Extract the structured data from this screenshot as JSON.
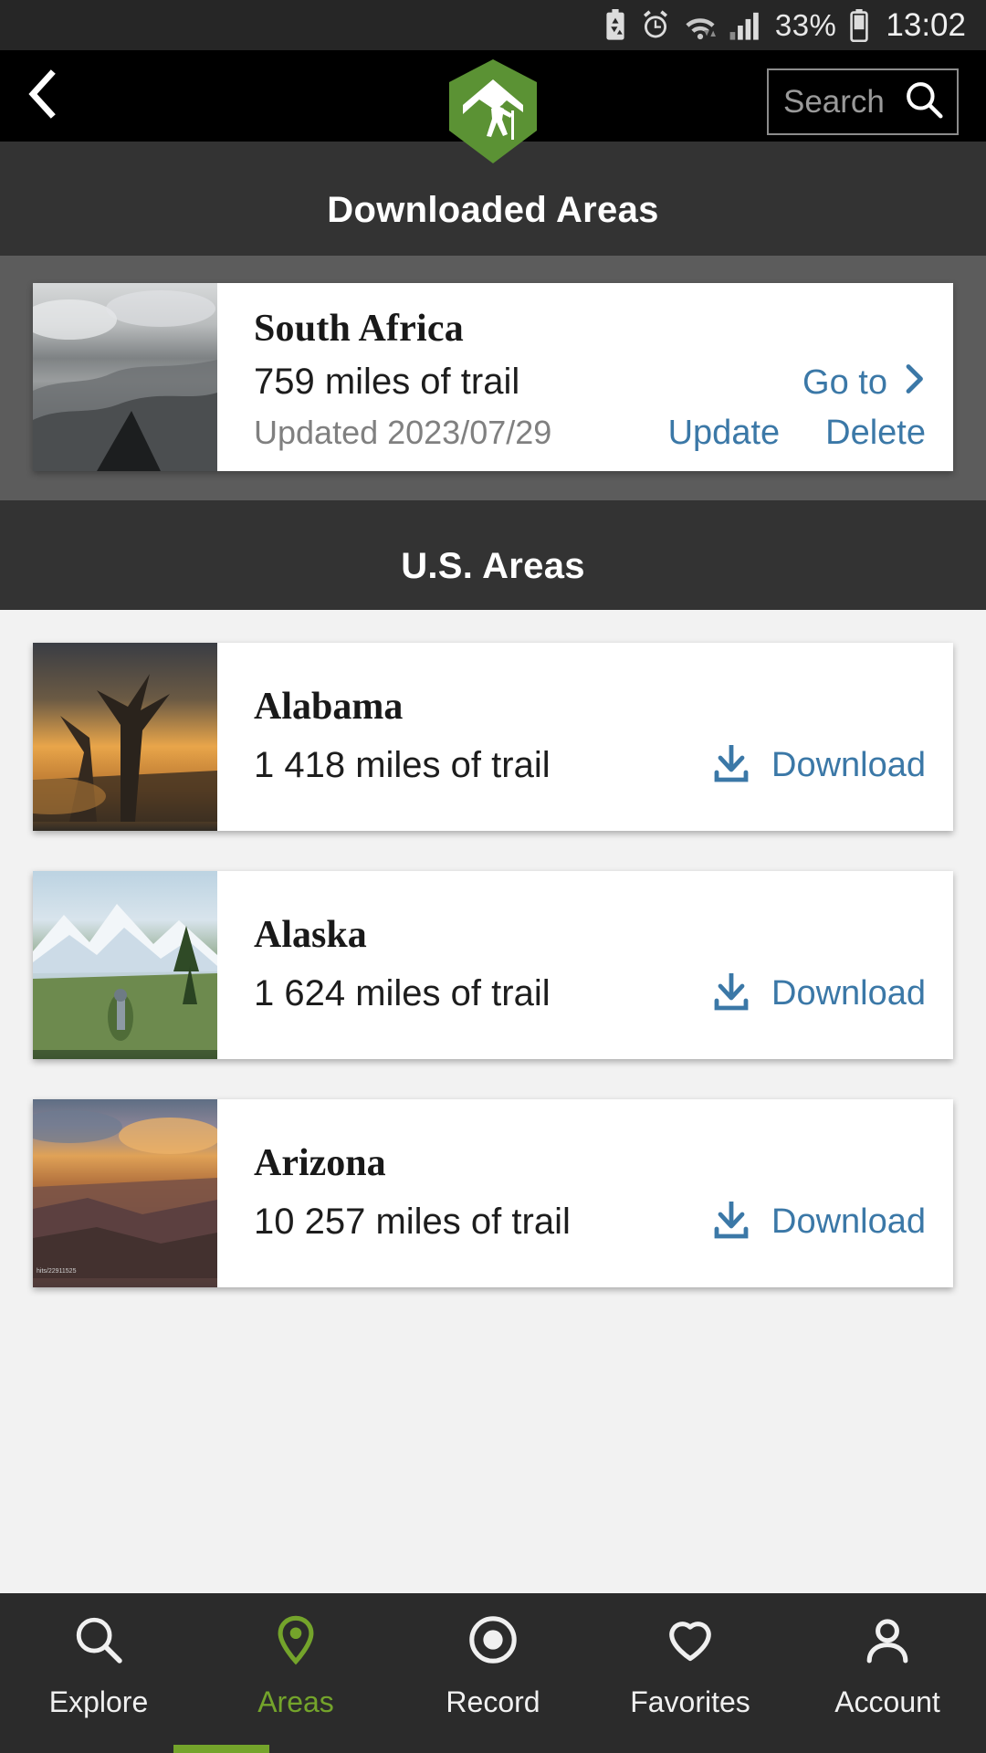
{
  "statusbar": {
    "icons": [
      "battery-saver-icon",
      "alarm-clock-icon",
      "wifi-icon",
      "cellular-signal-icon",
      "battery-icon"
    ],
    "battery_percent": "33%",
    "time": "13:02"
  },
  "appbar": {
    "back_icon": "chevron-left-icon",
    "logo_name": "hiker-hexagon-logo",
    "search": {
      "placeholder": "Search",
      "icon": "search-icon"
    }
  },
  "sections": {
    "downloaded_title": "Downloaded Areas",
    "us_title": "U.S. Areas"
  },
  "downloaded": [
    {
      "name": "South Africa",
      "miles": "759 miles of trail",
      "updated": "Updated 2023/07/29",
      "goto_label": "Go to",
      "goto_icon": "chevron-right-icon",
      "update_label": "Update",
      "delete_label": "Delete",
      "thumb_name": "south-africa-thumbnail"
    }
  ],
  "us_areas": [
    {
      "name": "Alabama",
      "miles": "1 418 miles of trail",
      "download_label": "Download",
      "download_icon": "download-icon",
      "thumb_name": "alabama-thumbnail"
    },
    {
      "name": "Alaska",
      "miles": "1 624 miles of trail",
      "download_label": "Download",
      "download_icon": "download-icon",
      "thumb_name": "alaska-thumbnail"
    },
    {
      "name": "Arizona",
      "miles": "10 257 miles of trail",
      "download_label": "Download",
      "download_icon": "download-icon",
      "thumb_name": "arizona-thumbnail"
    }
  ],
  "bottomnav": [
    {
      "label": "Explore",
      "icon": "search-icon",
      "active": false
    },
    {
      "label": "Areas",
      "icon": "map-pin-icon",
      "active": true
    },
    {
      "label": "Record",
      "icon": "record-icon",
      "active": false
    },
    {
      "label": "Favorites",
      "icon": "heart-icon",
      "active": false
    },
    {
      "label": "Account",
      "icon": "person-icon",
      "active": false
    }
  ],
  "colors": {
    "accent_green": "#74a42b",
    "link_blue": "#3b78a7",
    "header_dark": "#333333",
    "band_gray": "#5c5c5c",
    "page_bg": "#f2f2f2"
  }
}
